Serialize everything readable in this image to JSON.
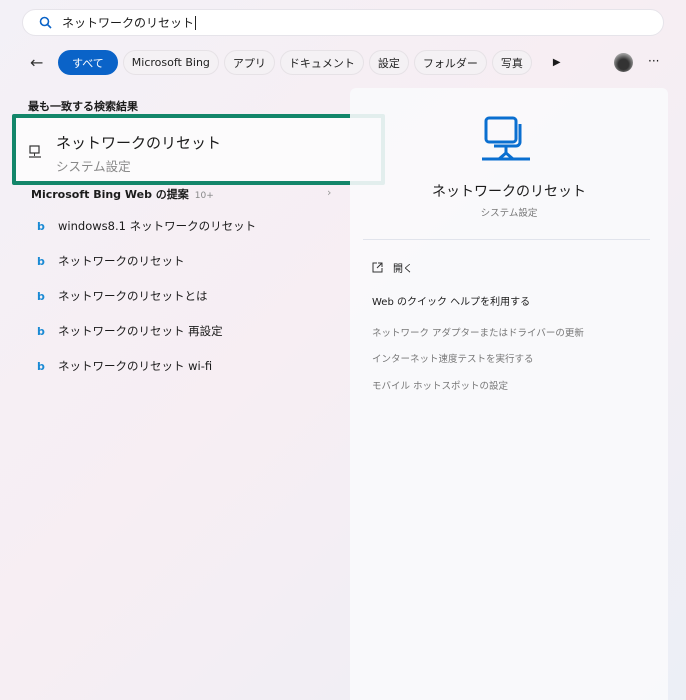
{
  "search": {
    "value": "ネットワークのリセット"
  },
  "filters": {
    "tabs": [
      "すべて",
      "Microsoft Bing",
      "アプリ",
      "ドキュメント",
      "設定",
      "フォルダー",
      "写真"
    ],
    "active": "すべて",
    "accent": "#0a63c8"
  },
  "best_match": {
    "heading": "最も一致する検索結果",
    "title": "ネットワークのリセット",
    "subtitle": "システム設定",
    "highlight": "#13866a"
  },
  "bing": {
    "heading": "Microsoft Bing Web の提案",
    "count": "10+",
    "suggestions": [
      "windows8.1 ネットワークのリセット",
      "ネットワークのリセット",
      "ネットワークのリセットとは",
      "ネットワークのリセット 再設定",
      "ネットワークのリセット wi-fi"
    ]
  },
  "detail": {
    "title": "ネットワークのリセット",
    "subtitle": "システム設定",
    "open": "開く",
    "quick_help": "Web のクイック ヘルプを利用する",
    "links": [
      "ネットワーク アダプターまたはドライバーの更新",
      "インターネット速度テストを実行する",
      "モバイル ホットスポットの設定"
    ]
  }
}
